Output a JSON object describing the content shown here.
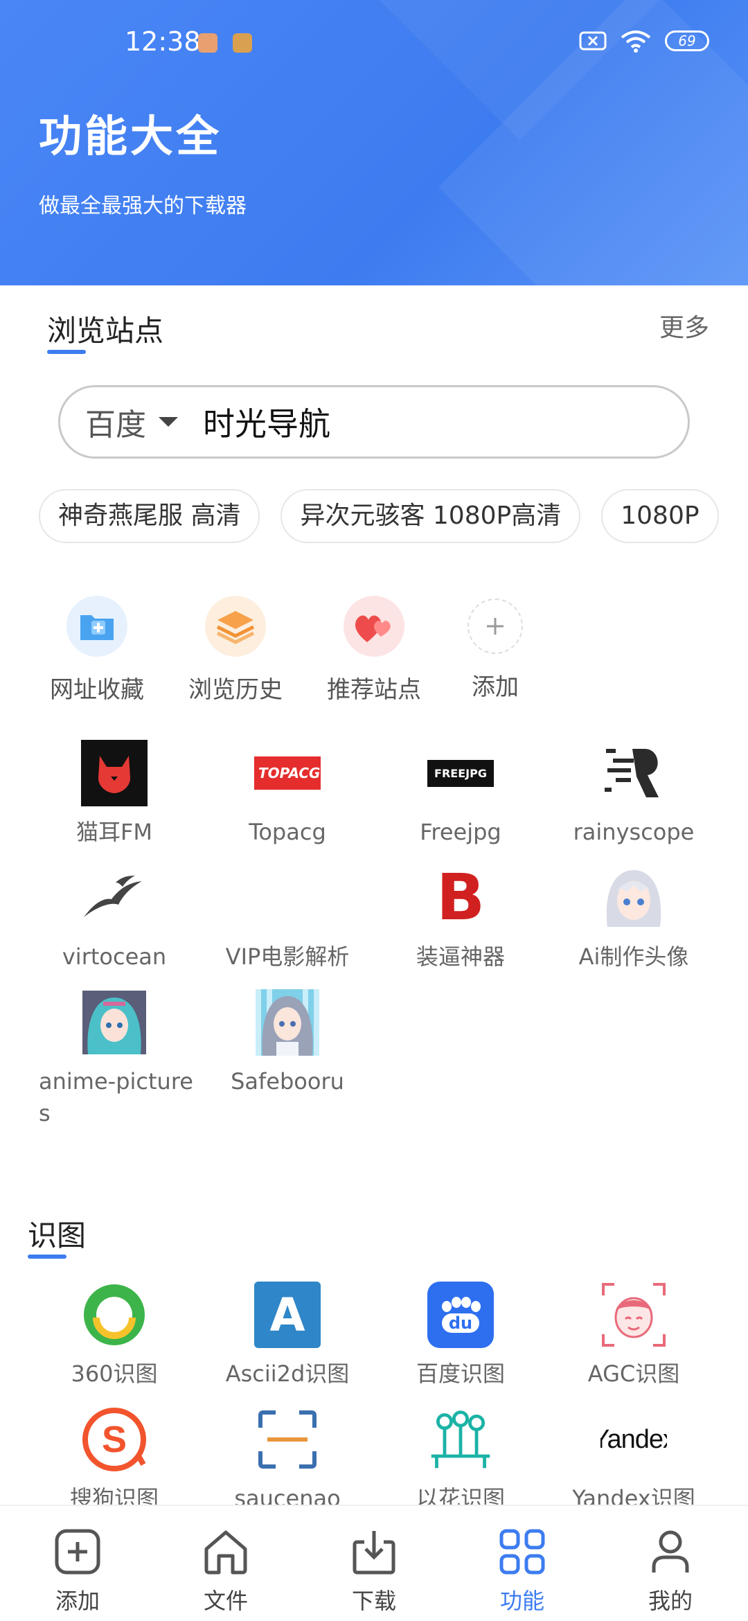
{
  "status": {
    "time": "12:38",
    "battery": "69"
  },
  "header": {
    "title": "功能大全",
    "subtitle": "做最全最强大的下载器"
  },
  "browse": {
    "title": "浏览站点",
    "more": "更多",
    "search": {
      "engine": "百度",
      "query": "时光导航"
    },
    "chips": [
      "神奇燕尾服 高清",
      "异次元骇客 1080P高清",
      "1080P"
    ],
    "quick": [
      {
        "label": "网址收藏",
        "icon": "folder-plus-icon"
      },
      {
        "label": "浏览历史",
        "icon": "layers-icon"
      },
      {
        "label": "推荐站点",
        "icon": "hearts-icon"
      },
      {
        "label": "添加",
        "icon": "plus-icon"
      }
    ],
    "sites": [
      {
        "label": "猫耳FM",
        "icon": "maoer-fm-logo"
      },
      {
        "label": "Topacg",
        "icon": "topacg-logo",
        "logo_text": "TOPACG"
      },
      {
        "label": "Freejpg",
        "icon": "freejpg-logo",
        "logo_text": "FREEJPG"
      },
      {
        "label": "rainyscope",
        "icon": "rainyscope-logo"
      },
      {
        "label": "virtocean",
        "icon": "birds-logo"
      },
      {
        "label": "VIP电影解析",
        "icon": "vip-blank-icon"
      },
      {
        "label": "装逼神器",
        "icon": "b-logo",
        "logo_text": "B"
      },
      {
        "label": "Ai制作头像",
        "icon": "anime-girl-avatar"
      },
      {
        "label": "anime-pictures",
        "icon": "anime-pictures-thumb"
      },
      {
        "label": "Safebooru",
        "icon": "safebooru-thumb"
      }
    ]
  },
  "identify": {
    "title": "识图",
    "items": [
      {
        "label": "360识图",
        "icon": "360-logo"
      },
      {
        "label": "Ascii2d识图",
        "icon": "ascii2d-logo",
        "logo_text": "A"
      },
      {
        "label": "百度识图",
        "icon": "baidu-paw-logo",
        "logo_text": "du"
      },
      {
        "label": "AGC识图",
        "icon": "agc-face-logo"
      },
      {
        "label": "搜狗识图",
        "icon": "sogou-logo",
        "logo_text": "S"
      },
      {
        "label": "saucenao",
        "icon": "scan-frame-icon"
      },
      {
        "label": "以花识图",
        "icon": "flower-logo"
      },
      {
        "label": "Yandex识图",
        "icon": "yandex-logo",
        "logo_text": "Yandex"
      }
    ]
  },
  "tabs": [
    {
      "label": "添加",
      "icon": "add-square-icon",
      "active": false
    },
    {
      "label": "文件",
      "icon": "home-folder-icon",
      "active": false
    },
    {
      "label": "下载",
      "icon": "download-tray-icon",
      "active": false
    },
    {
      "label": "功能",
      "icon": "grid-icon",
      "active": true
    },
    {
      "label": "我的",
      "icon": "user-icon",
      "active": false
    }
  ],
  "colors": {
    "primary": "#3d7cf0",
    "header_bg": "#4a86f5"
  }
}
